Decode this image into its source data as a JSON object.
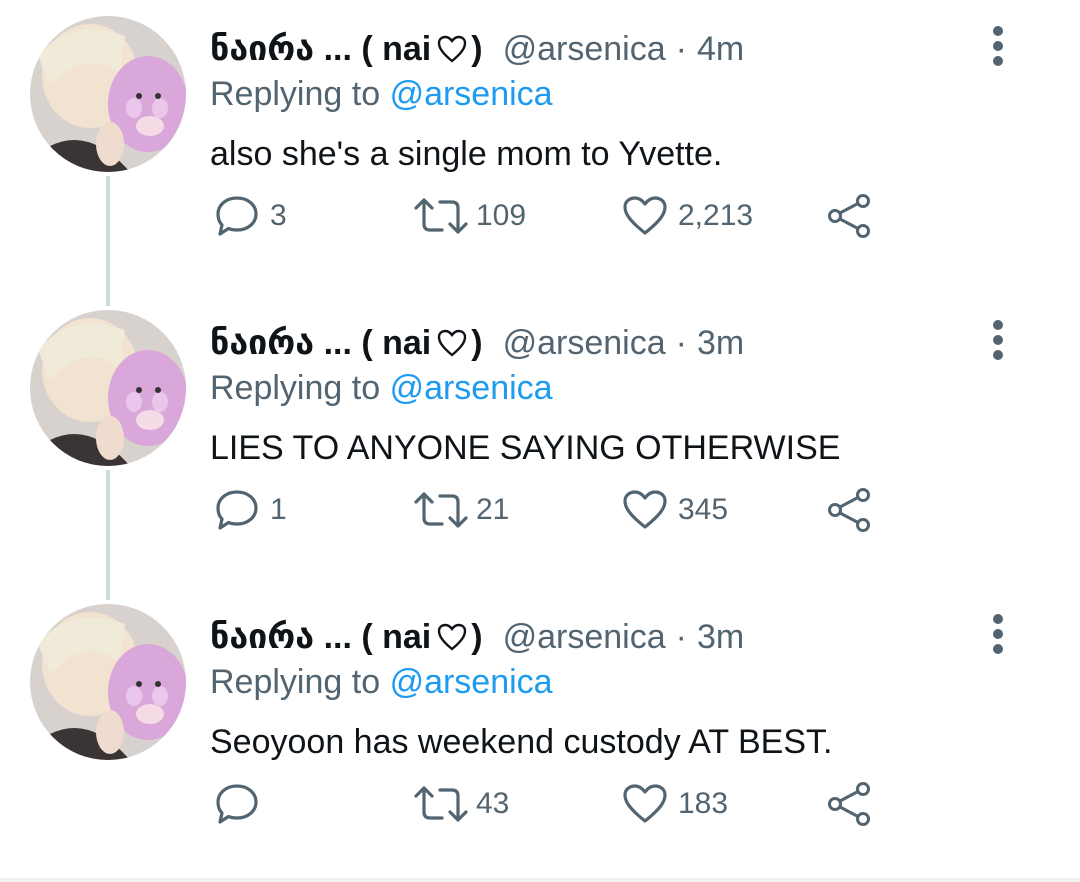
{
  "colors": {
    "accent": "#1d9bf0",
    "secondary": "#536471",
    "text": "#0f1419",
    "thread_line": "#cfd9de"
  },
  "icons": {
    "reply": "speech-bubble-icon",
    "retweet": "retweet-arrows-icon",
    "like": "heart-outline-icon",
    "share": "share-nodes-icon",
    "more": "vertical-ellipsis-icon"
  },
  "tweets": [
    {
      "name": "ნაირა ... ( nai",
      "handle": "@arsenica",
      "separator": "·",
      "time": "4m",
      "replying_prefix": "Replying to",
      "replying_to": "@arsenica",
      "text": "also she's a single mom to Yvette.",
      "replies": "3",
      "retweets": "109",
      "likes": "2,213"
    },
    {
      "name": "ნაირა ... ( nai",
      "handle": "@arsenica",
      "separator": "·",
      "time": "3m",
      "replying_prefix": "Replying to",
      "replying_to": "@arsenica",
      "text": "LIES TO ANYONE SAYING OTHERWISE",
      "replies": "1",
      "retweets": "21",
      "likes": "345"
    },
    {
      "name": "ნაირა ... ( nai",
      "handle": "@arsenica",
      "separator": "·",
      "time": "3m",
      "replying_prefix": "Replying to",
      "replying_to": "@arsenica",
      "text": "Seoyoon has weekend custody AT BEST.",
      "replies": "",
      "retweets": "43",
      "likes": "183"
    }
  ]
}
